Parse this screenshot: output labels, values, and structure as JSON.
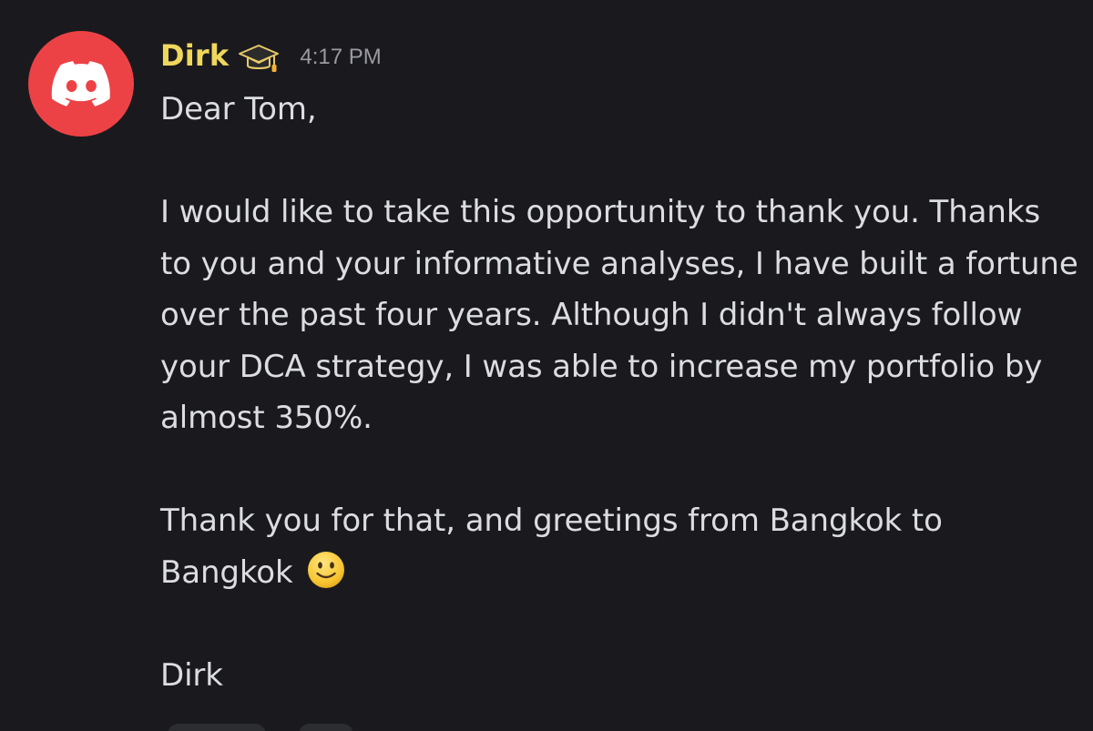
{
  "message": {
    "author": "Dirk",
    "role_icon": "graduation-cap-icon",
    "timestamp": "4:17 PM",
    "avatar": {
      "icon": "discord-logo-icon",
      "background": "#ed4245"
    },
    "username_color": "#f0d75c",
    "paragraphs": [
      "Dear Tom,",
      "I would like to take this opportunity to thank you. Thanks to you and your informative analyses, I have built a fortune over the past four years. Although I didn't always follow your DCA strategy, I was able to increase my portfolio by almost 350%.",
      "Thank you for that, and greetings from Bangkok to Bangkok",
      "Dirk"
    ],
    "emoji": "slightly-smiling-face-icon"
  },
  "colors": {
    "background": "#1a1a1e",
    "text": "#dcdde0",
    "timestamp": "#9a9ba1"
  }
}
